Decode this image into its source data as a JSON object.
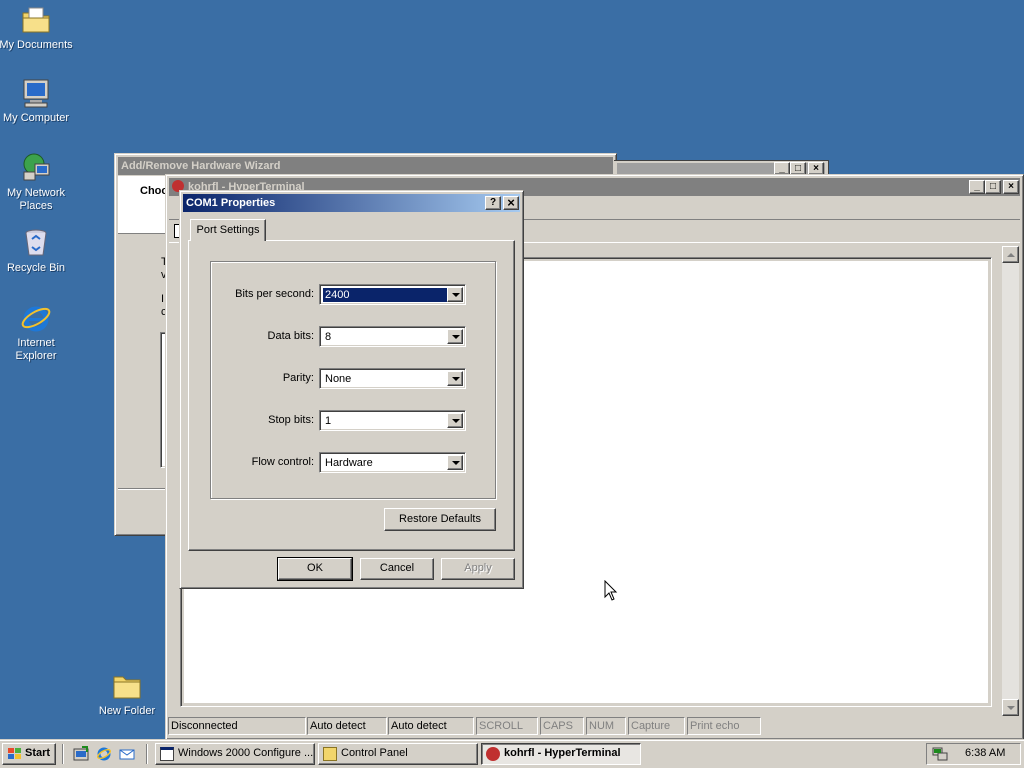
{
  "desktop": {
    "icons": [
      {
        "label": "My Documents"
      },
      {
        "label": "My Computer"
      },
      {
        "label": "My Network Places"
      },
      {
        "label": "Recycle Bin"
      },
      {
        "label": "Internet Explorer"
      },
      {
        "label": "New Folder"
      }
    ]
  },
  "wizard": {
    "title": "Add/Remove Hardware Wizard",
    "heading_fragment": "Choo",
    "text_fragments": [
      "T",
      "v",
      "I",
      "c"
    ]
  },
  "hyperterminal": {
    "title": "kohrfl - HyperTerminal",
    "status": {
      "connection": "Disconnected",
      "detect1": "Auto detect",
      "detect2": "Auto detect",
      "scroll": "SCROLL",
      "caps": "CAPS",
      "num": "NUM",
      "capture": "Capture",
      "print_echo": "Print echo"
    }
  },
  "dialog": {
    "title": "COM1 Properties",
    "help_btn": "?",
    "close_btn": "×",
    "tab": "Port Settings",
    "fields": [
      {
        "label": "Bits per second:",
        "value": "2400"
      },
      {
        "label": "Data bits:",
        "value": "8"
      },
      {
        "label": "Parity:",
        "value": "None"
      },
      {
        "label": "Stop bits:",
        "value": "1"
      },
      {
        "label": "Flow control:",
        "value": "Hardware"
      }
    ],
    "restore_defaults": "Restore Defaults",
    "ok": "OK",
    "cancel": "Cancel",
    "apply": "Apply"
  },
  "taskbar": {
    "start": "Start",
    "tasks": [
      {
        "label": "Windows 2000 Configure ..."
      },
      {
        "label": "Control Panel"
      },
      {
        "label": "kohrfl - HyperTerminal"
      }
    ],
    "clock": "6:38 AM"
  },
  "colors": {
    "desktop": "#3a6ea5",
    "active_title": "#0a246a",
    "face": "#d4d0c8"
  }
}
